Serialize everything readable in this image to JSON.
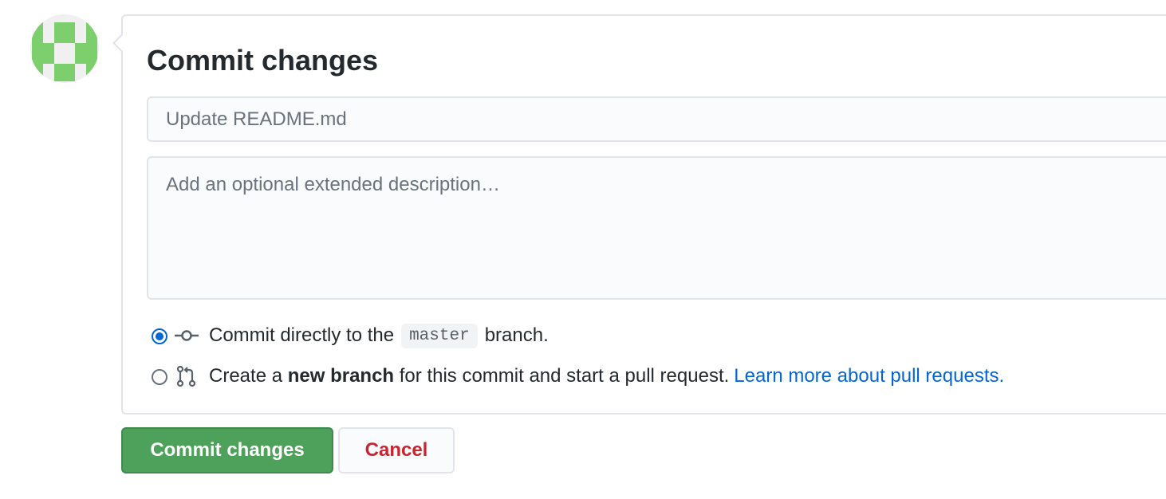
{
  "avatar": {
    "icon": "identicon-avatar",
    "color": "#7ccf6c"
  },
  "form": {
    "title": "Commit changes",
    "summary_placeholder": "Update README.md",
    "description_placeholder": "Add an optional extended description…"
  },
  "options": {
    "direct": {
      "selected": true,
      "icon": "git-commit-icon",
      "text_before": "Commit directly to the",
      "branch": "master",
      "text_after": "branch."
    },
    "new_branch": {
      "selected": false,
      "icon": "git-pull-request-icon",
      "text_before": "Create a",
      "bold_text": "new branch",
      "text_after": "for this commit and start a pull request.",
      "link_text": "Learn more about pull requests."
    }
  },
  "buttons": {
    "commit_label": "Commit changes",
    "cancel_label": "Cancel"
  },
  "colors": {
    "commit_button": "#4ea15b",
    "cancel_text": "#cb2431",
    "link": "#0366d6",
    "radio_selected": "#0366d6"
  }
}
